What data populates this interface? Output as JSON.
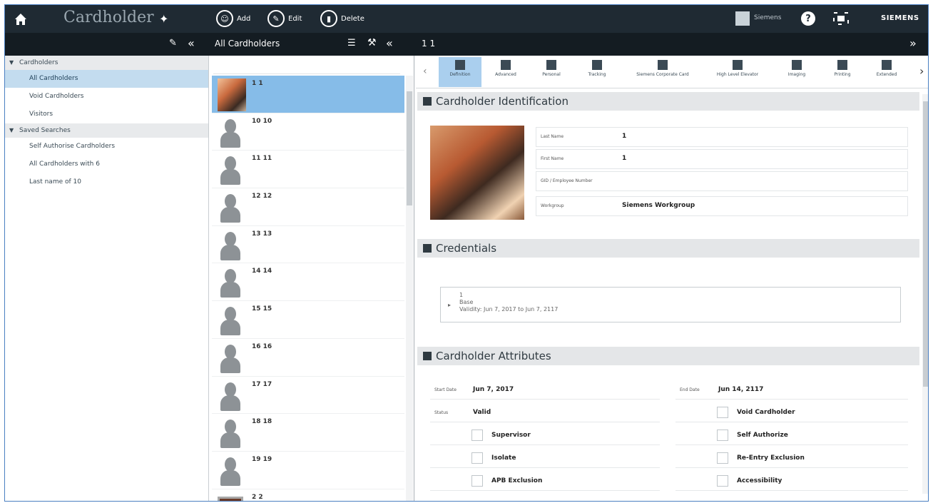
{
  "header": {
    "app_title": "Cardholder",
    "add_label": "Add",
    "edit_label": "Edit",
    "delete_label": "Delete",
    "user_name": "Siemens",
    "brand": "SIEMENS"
  },
  "subbar": {
    "list_title": "All Cardholders",
    "detail_title": "1 1"
  },
  "sidebar": {
    "groups": [
      {
        "label": "Cardholders",
        "items": [
          "All Cardholders",
          "Void Cardholders",
          "Visitors"
        ]
      },
      {
        "label": "Saved Searches",
        "items": [
          "Self Authorise Cardholders",
          "All Cardholders with 6",
          "Last name of 10"
        ]
      }
    ],
    "selected": "All Cardholders"
  },
  "list": {
    "rows": [
      "1 1",
      "10 10",
      "11 11",
      "12 12",
      "13 13",
      "14 14",
      "15 15",
      "16 16",
      "17 17",
      "18 18",
      "19 19",
      "2 2"
    ]
  },
  "tabs": [
    "Definition",
    "Advanced",
    "Personal",
    "Tracking",
    "Siemens Corporate Card",
    "High Level Elevator",
    "Imaging",
    "Printing",
    "Extended"
  ],
  "identification": {
    "title": "Cardholder Identification",
    "fields": [
      {
        "label": "Last Name",
        "value": "1"
      },
      {
        "label": "First Name",
        "value": "1"
      },
      {
        "label": "GID / Employee Number",
        "value": ""
      },
      {
        "label": "Workgroup",
        "value": "Siemens Workgroup"
      }
    ]
  },
  "credentials": {
    "title": "Credentials",
    "number": "1",
    "type": "Base",
    "validity": "Validity: Jun 7, 2017 to Jun 7, 2117"
  },
  "attributes": {
    "title": "Cardholder Attributes",
    "start_label": "Start Date",
    "start_value": "Jun 7, 2017",
    "end_label": "End Date",
    "end_value": "Jun 14, 2117",
    "status_label": "Status",
    "status_value": "Valid",
    "checkboxes_left": [
      "Supervisor",
      "Isolate",
      "APB Exclusion"
    ],
    "checkboxes_right": [
      "Void Cardholder",
      "Self Authorize",
      "Re-Entry Exclusion",
      "Accessibility"
    ]
  }
}
